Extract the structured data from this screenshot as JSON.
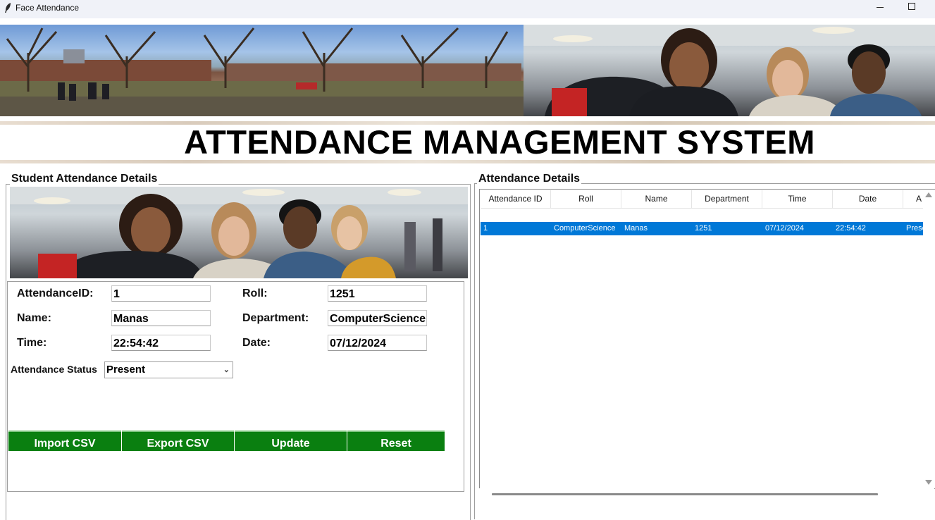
{
  "window": {
    "title": "Face Attendance",
    "controls": [
      "minimize",
      "maximize"
    ]
  },
  "header": {
    "title": "ATTENDANCE MANAGEMENT SYSTEM"
  },
  "left_panel": {
    "title": "Student Attendance Details",
    "fields": {
      "attendance_id": {
        "label": "AttendanceID:",
        "value": "1"
      },
      "roll": {
        "label": "Roll:",
        "value": "1251"
      },
      "name": {
        "label": "Name:",
        "value": "Manas"
      },
      "department": {
        "label": "Department:",
        "value": "ComputerScience"
      },
      "time": {
        "label": "Time:",
        "value": "22:54:42"
      },
      "date": {
        "label": "Date:",
        "value": "07/12/2024"
      }
    },
    "status": {
      "label": "Attendance Status",
      "value": "Present"
    },
    "buttons": {
      "import_csv": "Import CSV",
      "export_csv": "Export CSV",
      "update": "Update",
      "reset": "Reset"
    },
    "button_color": "#0a7f10"
  },
  "right_panel": {
    "title": "Attendance Details",
    "columns": [
      "Attendance ID",
      "Roll",
      "Name",
      "Department",
      "Time",
      "Date",
      "A"
    ],
    "rows": [
      [
        "1",
        "ComputerScience",
        "Manas",
        "1251",
        "07/12/2024",
        "22:54:42",
        "Present"
      ]
    ],
    "selected_row_color": "#0078d7"
  }
}
